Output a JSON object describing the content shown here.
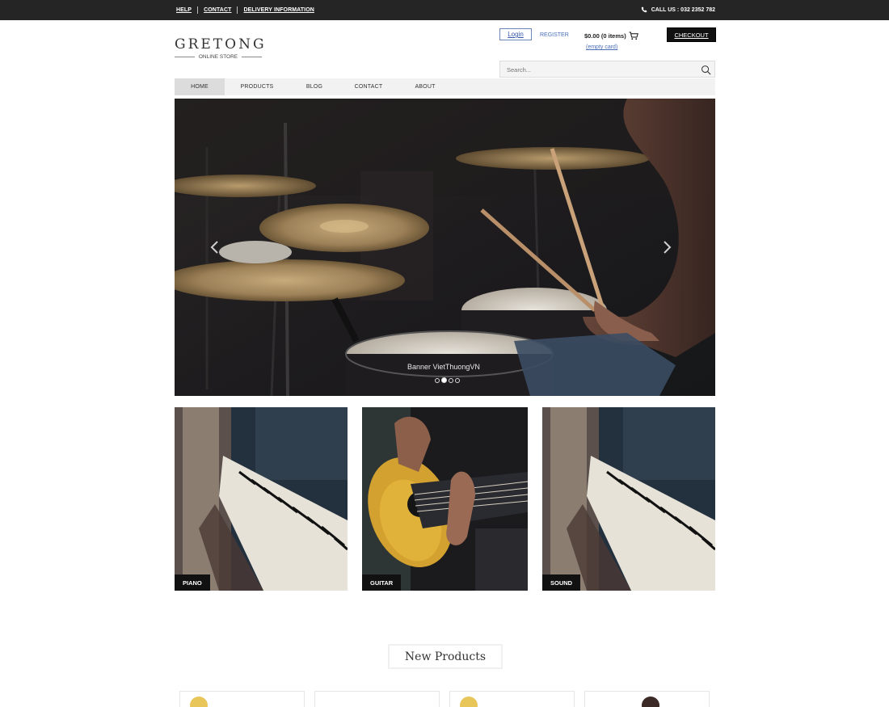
{
  "topbar": {
    "links": [
      "HELP",
      "CONTACT",
      "DELIVERY INFORMATION"
    ],
    "call_us": "CALL US : 032 2352 782"
  },
  "header": {
    "logo_title": "GRETONG",
    "logo_subtitle": "ONLINE STORE",
    "login_label": "Login",
    "register_label": "REGISTER",
    "cart_summary": "$0.00 (0 items)",
    "empty_card_label": "(empty card)",
    "checkout_label": "CHECKOUT",
    "search_placeholder": "Search..."
  },
  "nav": {
    "items": [
      "HOME",
      "PRODUCTS",
      "BLOG",
      "CONTACT",
      "ABOUT"
    ],
    "active": "HOME"
  },
  "hero": {
    "caption": "Banner VietThuongVN",
    "slide_count": 4,
    "active_slide": 2
  },
  "categories": [
    {
      "label": "PIANO"
    },
    {
      "label": "GUITAR"
    },
    {
      "label": "SOUND"
    }
  ],
  "new_products": {
    "title": "New Products"
  },
  "icons": {
    "phone": "phone-icon",
    "cart": "cart-icon",
    "search": "search-icon",
    "prev": "chevron-left-icon",
    "next": "chevron-right-icon"
  }
}
